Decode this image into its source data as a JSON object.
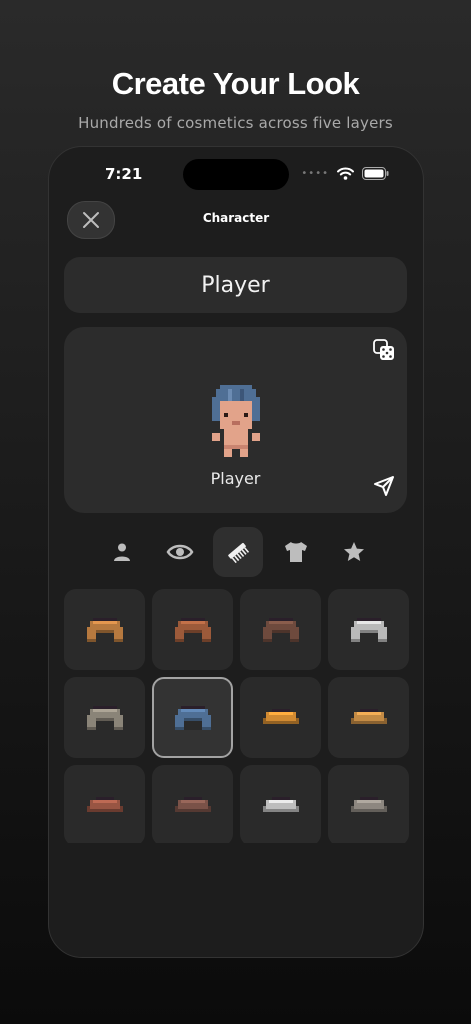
{
  "promo": {
    "headline": "Create Your Look",
    "subline": "Hundreds of cosmetics across five layers"
  },
  "status_bar": {
    "time": "7:21",
    "dots": "••••"
  },
  "nav": {
    "title": "Character",
    "close_icon": "close-icon"
  },
  "name_field": {
    "value": "Player"
  },
  "preview": {
    "name": "Player",
    "randomize_icon": "dice-icon",
    "share_icon": "send-icon"
  },
  "tabs": [
    {
      "icon": "person-icon",
      "active": false
    },
    {
      "icon": "eye-icon",
      "active": false
    },
    {
      "icon": "comb-icon",
      "active": true
    },
    {
      "icon": "shirt-icon",
      "active": false
    },
    {
      "icon": "star-icon",
      "active": false
    }
  ],
  "hair_items": [
    {
      "color": "#b6793f",
      "style": "long",
      "selected": false
    },
    {
      "color": "#9c5a3a",
      "style": "long",
      "selected": false
    },
    {
      "color": "#6e4a3d",
      "style": "long",
      "selected": false
    },
    {
      "color": "#b9b9b9",
      "style": "long",
      "selected": false
    },
    {
      "color": "#8a8478",
      "style": "long",
      "selected": false
    },
    {
      "color": "#4f6f95",
      "style": "long",
      "selected": true
    },
    {
      "color": "#d08a32",
      "style": "short",
      "selected": false
    },
    {
      "color": "#c38b45",
      "style": "short",
      "selected": false
    },
    {
      "color": "#985543",
      "style": "short",
      "selected": false
    },
    {
      "color": "#7a5248",
      "style": "short",
      "selected": false
    },
    {
      "color": "#bdbdbd",
      "style": "short",
      "selected": false
    },
    {
      "color": "#8d8780",
      "style": "short",
      "selected": false
    }
  ]
}
